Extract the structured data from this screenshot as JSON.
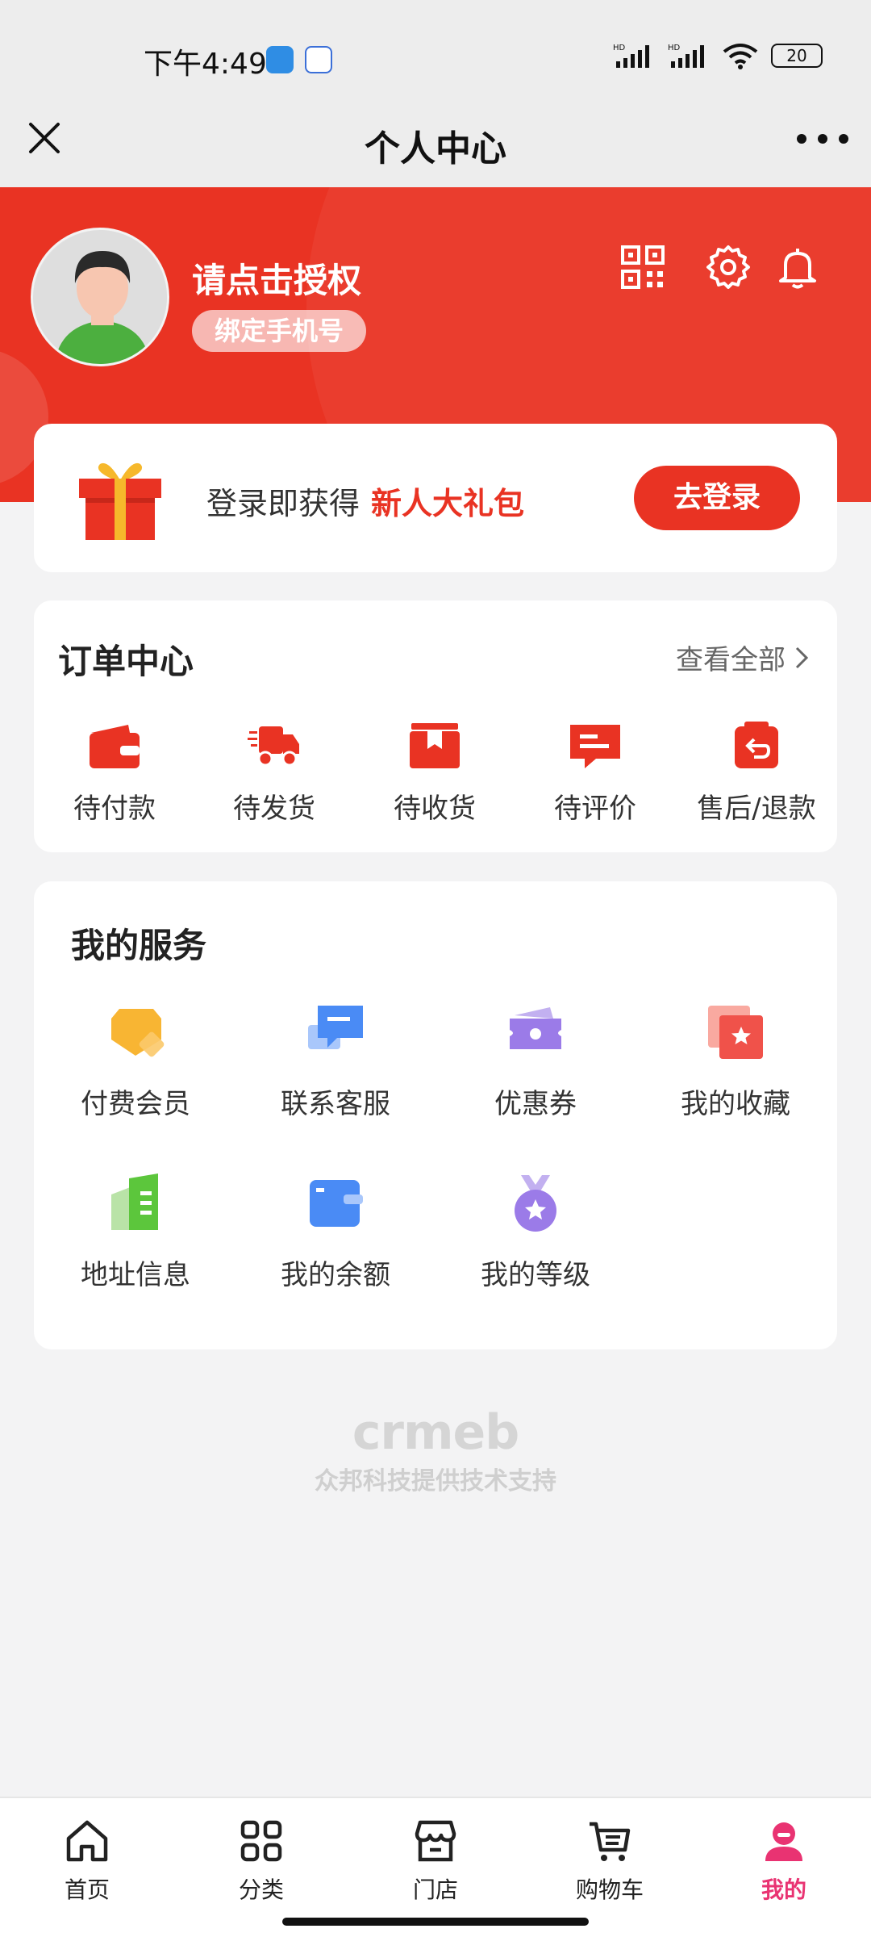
{
  "status_bar": {
    "time": "下午4:49",
    "battery": "20"
  },
  "nav": {
    "title": "个人中心"
  },
  "profile": {
    "name": "请点击授权",
    "bind_phone": "绑定手机号"
  },
  "login_card": {
    "text": "登录即获得",
    "highlight": "新人大礼包",
    "button": "去登录"
  },
  "orders": {
    "title": "订单中心",
    "view_all": "查看全部",
    "items": [
      {
        "label": "待付款",
        "icon": "wallet-icon"
      },
      {
        "label": "待发货",
        "icon": "truck-icon"
      },
      {
        "label": "待收货",
        "icon": "box-icon"
      },
      {
        "label": "待评价",
        "icon": "review-icon"
      },
      {
        "label": "售后/退款",
        "icon": "refund-icon"
      }
    ]
  },
  "services": {
    "title": "我的服务",
    "items": [
      {
        "label": "付费会员",
        "icon": "vip-tag-icon"
      },
      {
        "label": "联系客服",
        "icon": "chat-icon"
      },
      {
        "label": "优惠券",
        "icon": "coupon-icon"
      },
      {
        "label": "我的收藏",
        "icon": "favorite-icon"
      },
      {
        "label": "地址信息",
        "icon": "address-icon"
      },
      {
        "label": "我的余额",
        "icon": "balance-icon"
      },
      {
        "label": "我的等级",
        "icon": "medal-icon"
      }
    ]
  },
  "brand": {
    "logo": "crmeb",
    "tagline": "众邦科技提供技术支持"
  },
  "tabs": [
    {
      "label": "首页",
      "icon": "home-icon"
    },
    {
      "label": "分类",
      "icon": "grid-icon"
    },
    {
      "label": "门店",
      "icon": "store-icon"
    },
    {
      "label": "购物车",
      "icon": "cart-icon"
    },
    {
      "label": "我的",
      "icon": "user-icon",
      "active": true
    }
  ],
  "colors": {
    "primary": "#e93323",
    "active_tab": "#e93372"
  }
}
